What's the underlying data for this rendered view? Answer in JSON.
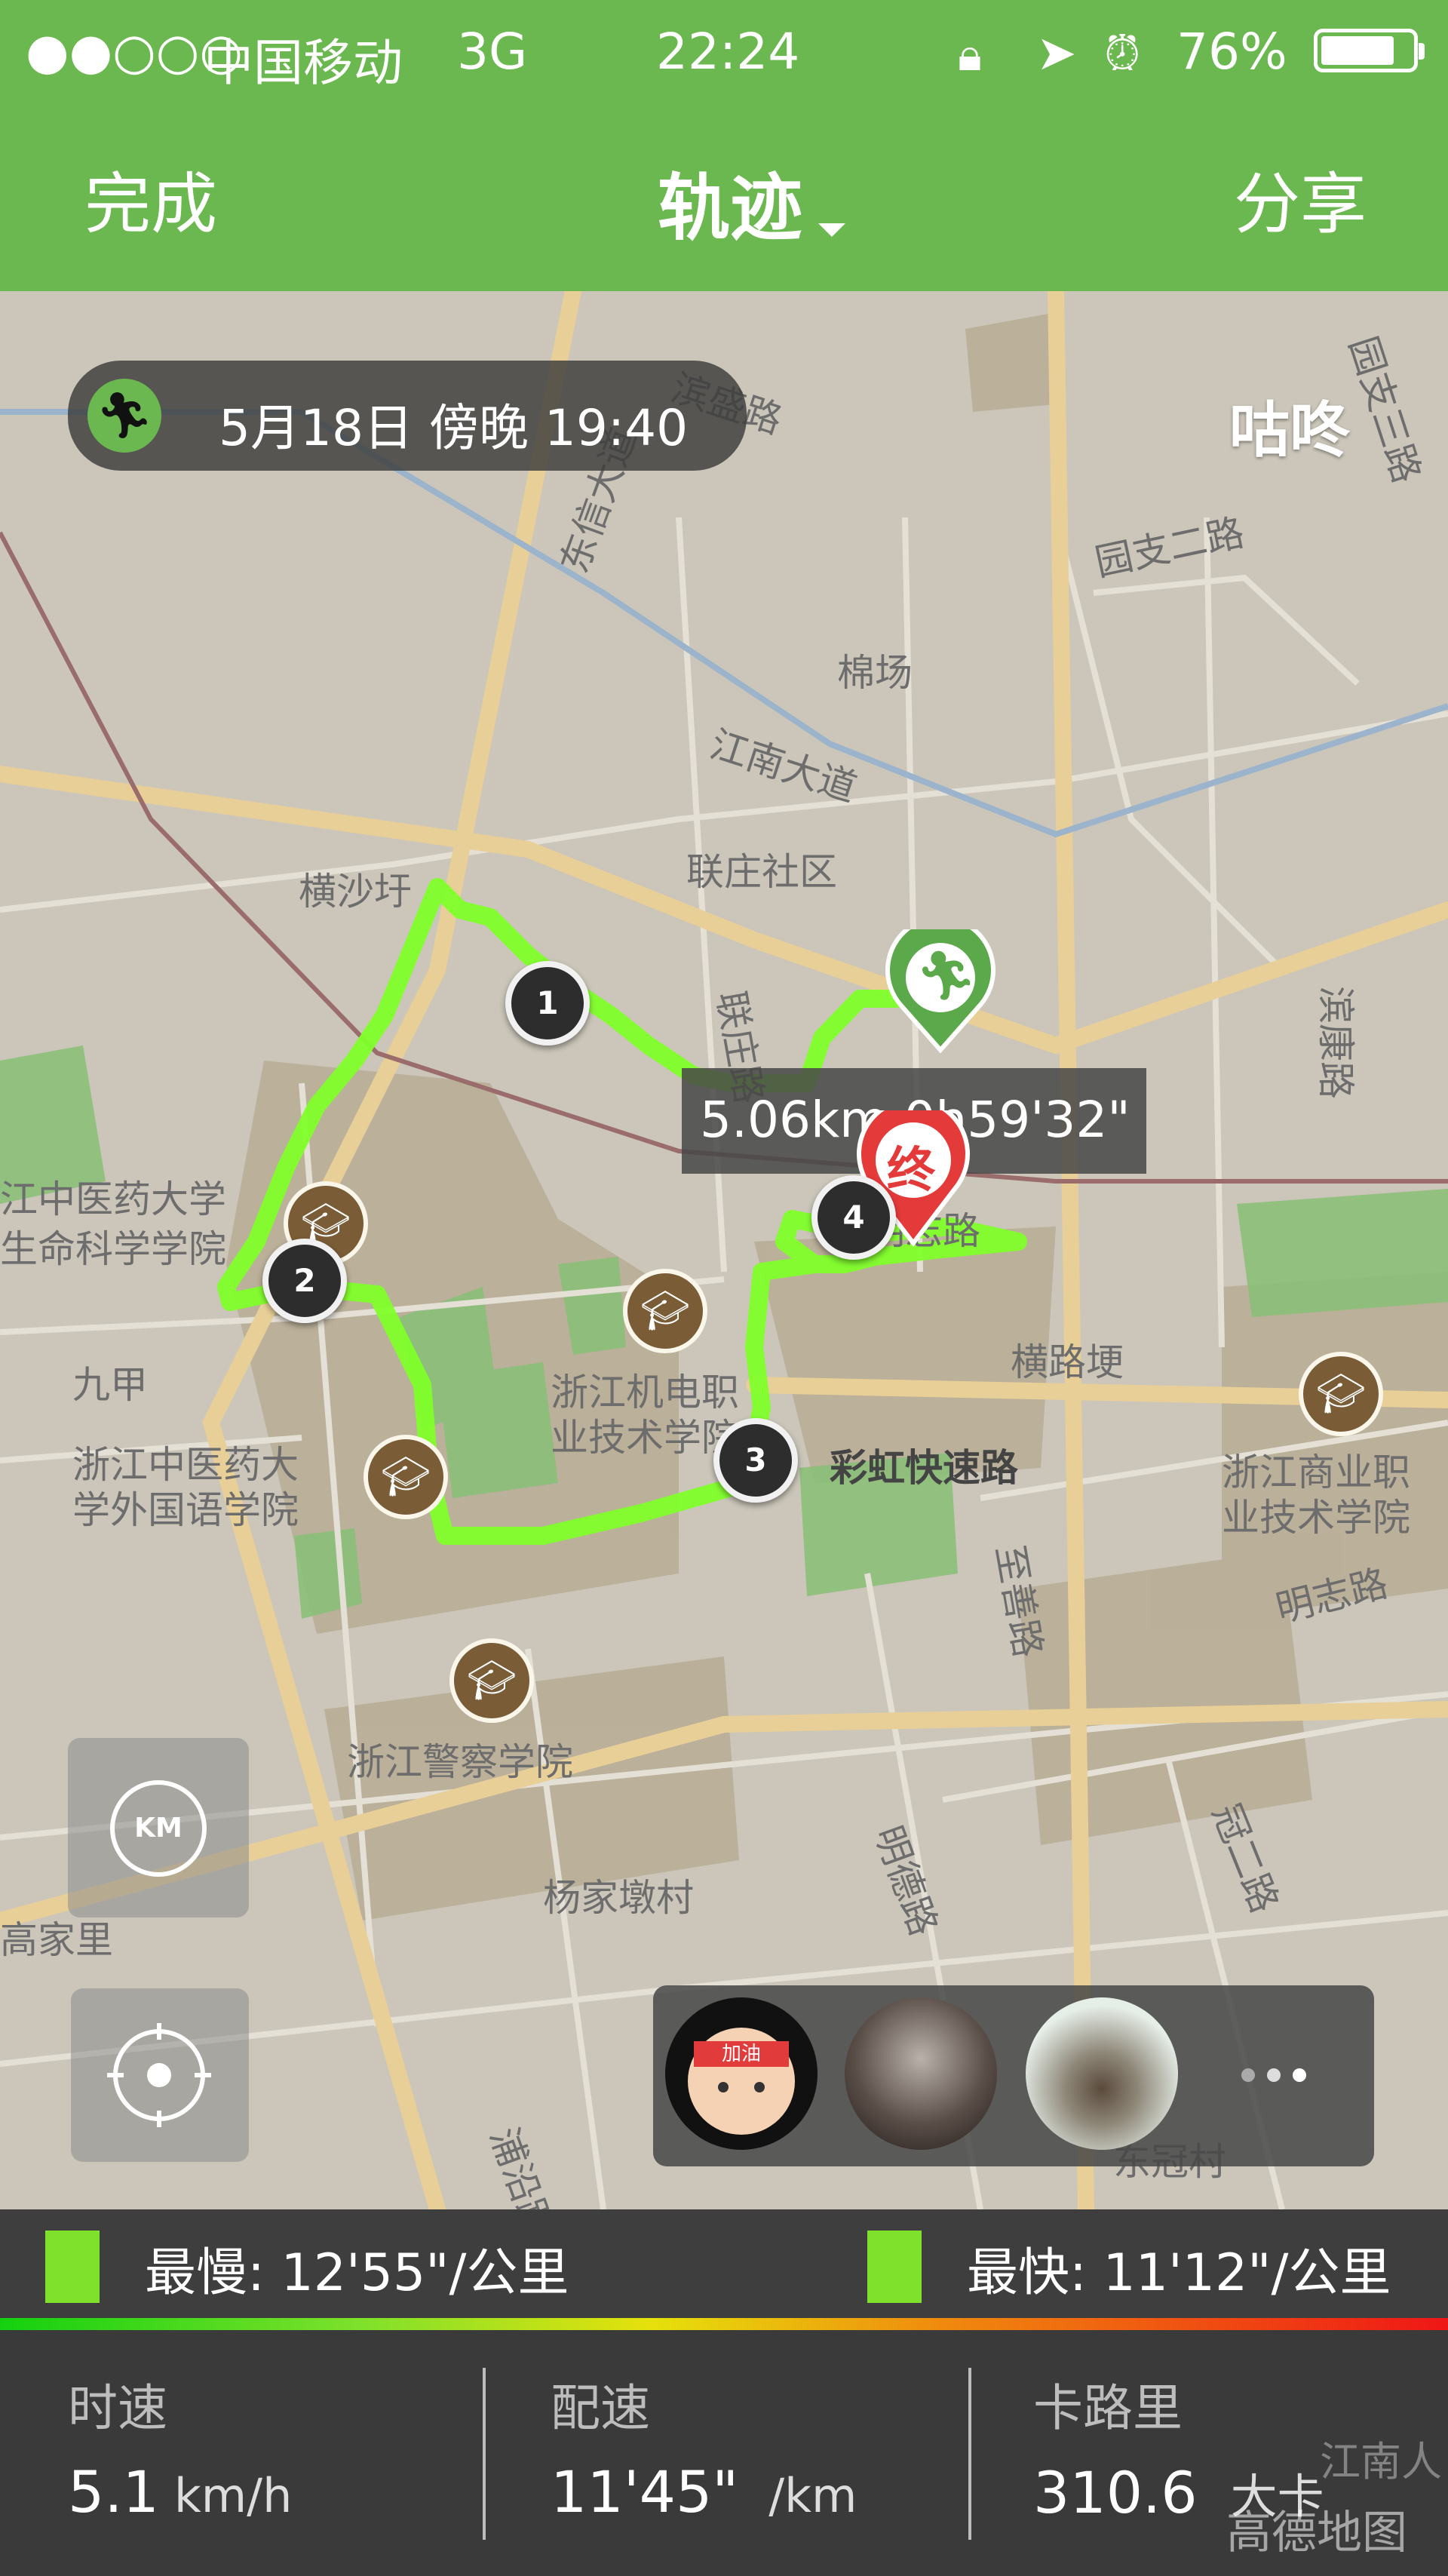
{
  "status_bar": {
    "signal": "●●○○○",
    "carrier": "中国移动",
    "network": "3G",
    "time": "22:24",
    "battery": "76%"
  },
  "nav": {
    "left": "完成",
    "title": "轨迹",
    "right": "分享"
  },
  "activity": {
    "datetime": "5月18日  傍晚  19:40",
    "user": "咕咚"
  },
  "route": {
    "summary": "5.06km  0h59'32\"",
    "end_label": "终",
    "markers": [
      "1",
      "2",
      "3",
      "4"
    ]
  },
  "map_labels": [
    "滨盛路",
    "东信大道",
    "江南大道",
    "棉场",
    "园支二路",
    "园支三路",
    "联庄社区",
    "横沙圩",
    "江中医药大学",
    "生命科学学院",
    "九甲",
    "浙江中医药大",
    "学外国语学院",
    "浙江机电职",
    "业技术学院",
    "彩虹快速路",
    "横路埂",
    "浙江商业职",
    "业技术学院",
    "明志路",
    "明德路",
    "浙江警察学院",
    "杨家墩村",
    "高家里",
    "冠二路",
    "至善路",
    "浦沿路",
    "东冠村",
    "滨康路",
    "联庄路",
    "明志路",
    "江南人",
    "高德地图"
  ],
  "controls": {
    "km": "KM"
  },
  "avatars": {
    "first": "加油"
  },
  "pace": {
    "slowest": "最慢: 12'55\"/公里",
    "fastest": "最快: 11'12\"/公里",
    "colors": {
      "slow": "#14d10f",
      "fast": "#ef1616"
    }
  },
  "stats": {
    "speed_label": "时速",
    "speed_value": "5.1",
    "speed_unit": "km/h",
    "pace_label": "配速",
    "pace_value": "11'45\"",
    "pace_unit": "/km",
    "cal_label": "卡路里",
    "cal_value": "310.6",
    "cal_unit": "大卡"
  }
}
